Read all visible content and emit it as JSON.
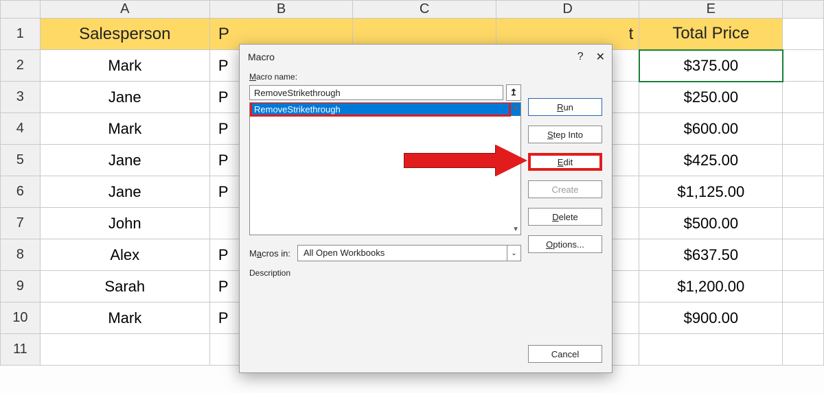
{
  "columns": [
    "A",
    "B",
    "C",
    "D",
    "E"
  ],
  "rows": [
    "1",
    "2",
    "3",
    "4",
    "5",
    "6",
    "7",
    "8",
    "9",
    "10",
    "11"
  ],
  "header": {
    "A": "Salesperson",
    "B": "P",
    "E": "Total Price",
    "E_partial_right": "t"
  },
  "data": {
    "A": [
      "Mark",
      "Jane",
      "Mark",
      "Jane",
      "Jane",
      "John",
      "Alex",
      "Sarah",
      "Mark"
    ],
    "B": [
      "P",
      "P",
      "P",
      "P",
      "P",
      "",
      "P",
      "P",
      "P"
    ],
    "E": [
      "$375.00",
      "$250.00",
      "$600.00",
      "$425.00",
      "$1,125.00",
      "$500.00",
      "$637.50",
      "$1,200.00",
      "$900.00"
    ]
  },
  "dialog": {
    "title": "Macro",
    "macro_name_label": "Macro name:",
    "macro_name_value": "RemoveStrikethrough",
    "list_selected": "RemoveStrikethrough",
    "macros_in_label": "Macros in:",
    "macros_in_value": "All Open Workbooks",
    "description_label": "Description",
    "buttons": {
      "run": "Run",
      "step_into": "Step Into",
      "edit": "Edit",
      "create": "Create",
      "delete": "Delete",
      "options": "Options...",
      "cancel": "Cancel"
    },
    "help": "?",
    "close": "✕"
  }
}
